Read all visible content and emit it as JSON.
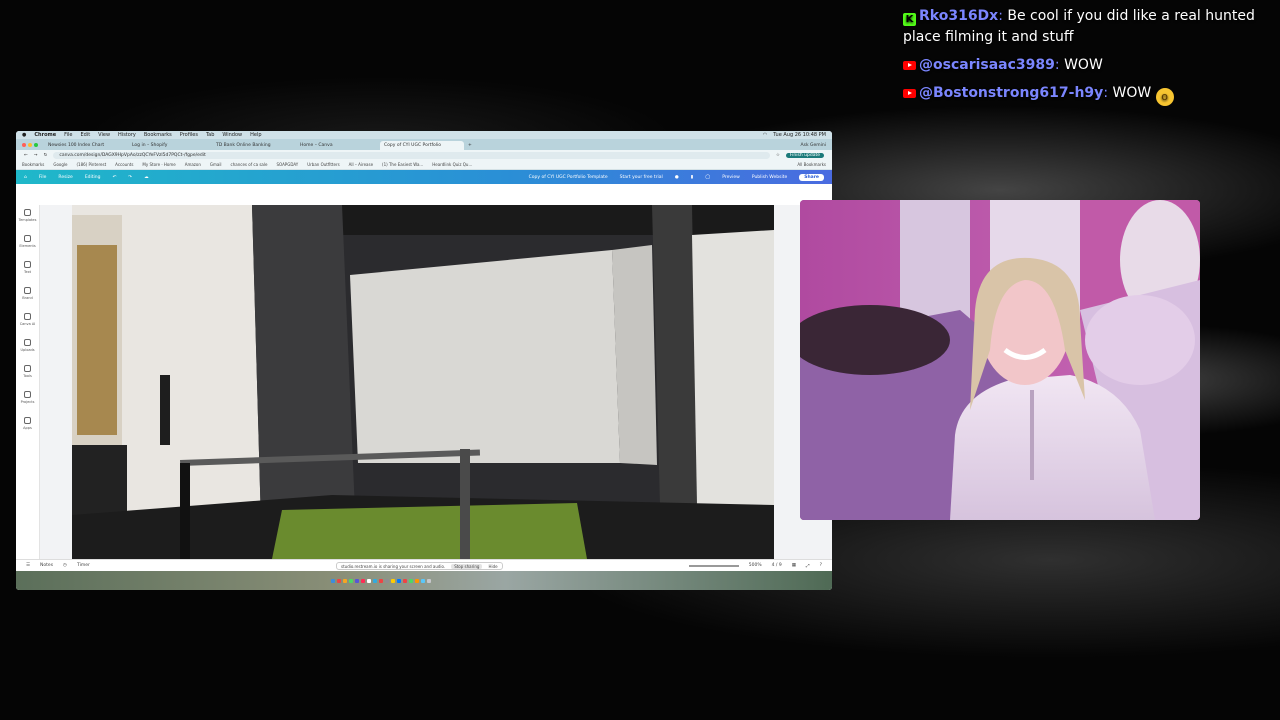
{
  "chat": {
    "messages": [
      {
        "platform": "kick-icon",
        "user": "Rko316Dx",
        "text": "Be cool if you did like a real hunted place filming it and stuff"
      },
      {
        "platform": "youtube-icon",
        "user": "@oscarisaac3989",
        "text": "WOW"
      },
      {
        "platform": "youtube-icon",
        "user": "@Bostonstrong617-h9y",
        "text": "WOW"
      }
    ],
    "colors": {
      "username": "#7b86ff",
      "kick": "#53fc18",
      "youtube": "#ff0000"
    }
  },
  "screen": {
    "mac_menu": {
      "items": [
        "Chrome",
        "File",
        "Edit",
        "View",
        "History",
        "Bookmarks",
        "Profiles",
        "Tab",
        "Window",
        "Help"
      ],
      "clock": "Tue Aug 26 10:48 PM"
    },
    "tabs": [
      "Newsies 100 Index Chart",
      "Log in – Shopify",
      "TD Bank Online Banking",
      "Home – Canva",
      "Copy of CYI UGC Portfolio"
    ],
    "url": "canva.com/design/DAGX9HpVpAo/zzQCYeFVzl5d7PQCt-/fgpe/edit",
    "ask_gemini": "Ask Gemini",
    "finish_update": "Finish update",
    "bookmarks": [
      "Bookmarks",
      "Google",
      "(186) Pinterest",
      "Accounts",
      "My Store · Home",
      "Amazon",
      "Gmail",
      "chances of ca sale",
      "SOAPGDAY",
      "Urban Outfitters",
      "All – Airease",
      "(1) The Easiest Wa...",
      "Heardlink Quiz Qu...",
      "All Bookmarks"
    ],
    "canva": {
      "left": [
        "File",
        "Resize",
        "Editing"
      ],
      "doc_title": "Copy of CYI UGC Portfolio Template",
      "trial": "Start your free trial",
      "preview": "Preview",
      "publish": "Publish Website",
      "share": "Share"
    },
    "sidebar": [
      "Templates",
      "Elements",
      "Text",
      "Brand",
      "Canva AI",
      "Uploads",
      "Tools",
      "Projects",
      "Apps"
    ],
    "status": {
      "notes": "Notes",
      "timer": "Timer",
      "zoom": "500%",
      "pages": "4 / 9"
    },
    "share_notice": {
      "text": "studio.restream.io is sharing your screen and audio.",
      "stop": "Stop sharing",
      "hide": "Hide"
    }
  }
}
